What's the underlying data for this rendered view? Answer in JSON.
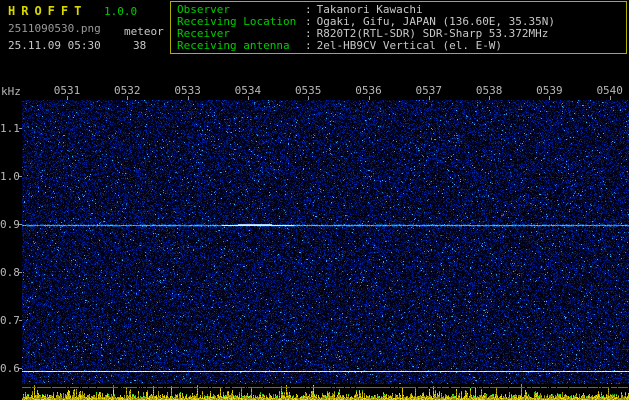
{
  "app": {
    "title": "HROFFT",
    "version": "1.0.0",
    "filename": "2511090530.png",
    "mode": "meteor",
    "datetime": "25.11.09 05:30",
    "count": "38"
  },
  "header": {
    "sep": ":",
    "rows": [
      {
        "label": "Observer",
        "value": "Takanori Kawachi"
      },
      {
        "label": "Receiving Location",
        "value": "Ogaki, Gifu, JAPAN (136.60E, 35.35N)"
      },
      {
        "label": "Receiver",
        "value": "R820T2(RTL-SDR) SDR-Sharp 53.372MHz"
      },
      {
        "label": "Receiving antenna",
        "value": "2el-HB9CV Vertical (el. E-W)"
      }
    ]
  },
  "chart_data": {
    "type": "heatmap",
    "title": "HROFFT radio-meteor spectrogram, 10-minute frame 05:30-05:40",
    "x_ticks": [
      "0531",
      "0532",
      "0533",
      "0534",
      "0535",
      "0536",
      "0537",
      "0538",
      "0539",
      "0540"
    ],
    "y_unit": "kHz",
    "y_ticks": [
      "1.1",
      "1.0",
      "0.9",
      "0.8",
      "0.7",
      "0.6"
    ],
    "ylim": [
      0.57,
      1.16
    ],
    "grid": false,
    "legend": "none",
    "features": {
      "carrier_line_khz": 0.9,
      "bright_echo_segment": "brighter white stretch on the 0.9 kHz line near 0533-0534",
      "reference_line_khz": 0.59,
      "background": "dark blue random noise speckle",
      "bottom_strip": "signal-level noise trace in yellow with green speckles"
    },
    "colors": {
      "background": "#000000",
      "noise_blue": "#0018a0",
      "carrier_line": "#9cc8ff",
      "reference_line": "#d8d8d8",
      "axis_text": "#b8b8b8",
      "label_green": "#00cc00",
      "title_yellow": "#d8d800",
      "strip_yellow": "#c8b400",
      "strip_green": "#30c030"
    }
  }
}
